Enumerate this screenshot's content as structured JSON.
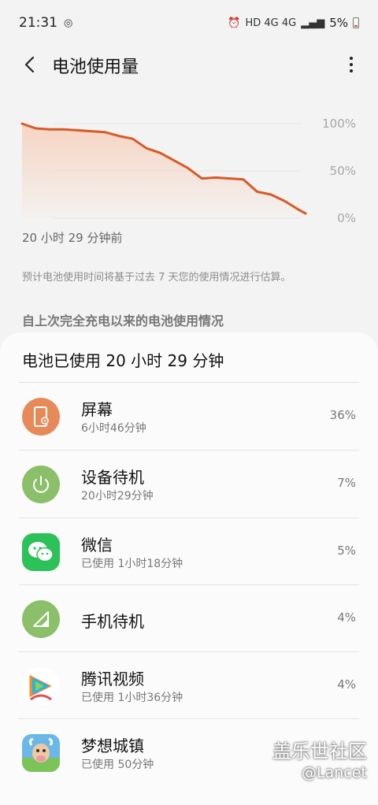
{
  "status_bar": {
    "time": "21:31",
    "indicators": "HD 4G 4G",
    "battery_percent": "5%"
  },
  "header": {
    "title": "电池使用量"
  },
  "chart_data": {
    "type": "area",
    "ylim": [
      0,
      100
    ],
    "y_tick_labels": [
      "100%",
      "50%",
      "0%"
    ],
    "x_caption": "20 小时 29 分钟前",
    "x": [
      0,
      1,
      2,
      3,
      4,
      5,
      6,
      7,
      8,
      9,
      10,
      11,
      12,
      13,
      14,
      15,
      16,
      17,
      18,
      19,
      20,
      20.5
    ],
    "series": [
      {
        "values": [
          100,
          95,
          94,
          94,
          93,
          92,
          91,
          87,
          84,
          74,
          69,
          61,
          53,
          42,
          43,
          42,
          41,
          28,
          25,
          18,
          9,
          5
        ]
      }
    ],
    "colors": {
      "line": "#d85a25",
      "fill": "#f6d2c0",
      "grid": "#e6e6e6"
    }
  },
  "note": "预计电池使用时间将基于过去 7 天您的使用情况进行估算。",
  "section_header": "自上次完全充电以来的电池使用情况",
  "usage": {
    "summary": "电池已使用 20 小时 29 分钟",
    "items": [
      {
        "name": "屏幕",
        "detail": "6小时46分钟",
        "percent": "36%",
        "icon": "screen-icon"
      },
      {
        "name": "设备待机",
        "detail": "20小时29分钟",
        "percent": "7%",
        "icon": "power-icon"
      },
      {
        "name": "微信",
        "detail": "已使用 1小时18分钟",
        "percent": "5%",
        "icon": "wechat-icon"
      },
      {
        "name": "手机待机",
        "detail": "",
        "percent": "4%",
        "icon": "signal-icon"
      },
      {
        "name": "腾讯视频",
        "detail": "已使用 1小时36分钟",
        "percent": "4%",
        "icon": "tencent-video-icon"
      },
      {
        "name": "梦想城镇",
        "detail": "已使用 50分钟",
        "percent": "",
        "icon": "township-icon"
      }
    ]
  },
  "watermark": {
    "main": "盖乐世社区",
    "user": "@Lancet"
  }
}
